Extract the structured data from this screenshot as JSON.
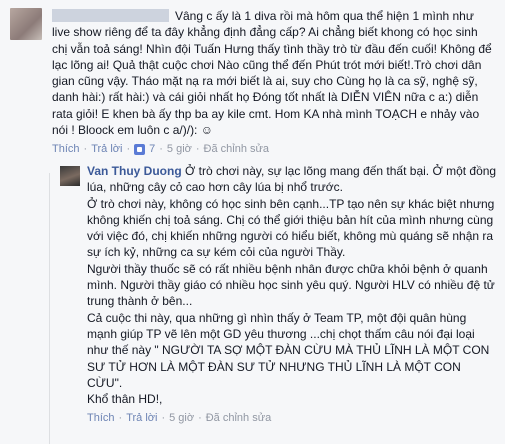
{
  "comment1": {
    "text": "Vâng c ấy là 1 diva rồi mà hôm qua thể hiện 1 mình như live show riêng để ta đây khẳng định đẳng cấp? Ai chẳng biết khong có học sinh chị vẫn toả sáng! Nhìn đội Tuấn Hưng thấy tình thầy trò từ đầu đến cuối! Không để lạc lõng ai! Quả thật cuộc chơi Nào cũng thể đến Phút trót mới biết!.Trò chơi dân gian cũng vậy. Tháo mặt nạ ra mới biết là ai, suy cho Cùng họ là ca sỹ, nghệ sỹ, danh hài:) rất hài:) và cái giỏi nhất họ Đóng tốt nhất là DIỄN VIÊN nữa c a:) diễn rata giỏi! E khen bà ấy thp ba ay kile cmt. Hom KA nhà mình TOẠCH e nhảy vào nói ! Bloock em luôn c a/)/): ☺",
    "actions": {
      "like": "Thích",
      "reply": "Trả lời",
      "like_count": "7",
      "time": "5 giờ",
      "edited": "Đã chỉnh sửa"
    }
  },
  "comment2": {
    "author": "Van Thuy Duong",
    "text": "Ở trò chơi này, sự lạc lõng mang đến thất bại. Ở một đồng lúa, những cây cỏ cao hơn cây lúa bị nhổ trước.\nỞ trò chơi này, không có học sinh bên cạnh...TP tạo nên sự khác biệt nhưng không khiến chị toả sáng. Chị có thể giới thiệu bản hít của mình nhưng cùng với việc đó, chị khiến những người có hiểu biết, không mù quáng sẽ nhận ra sự ích kỷ, những ca sự kém cỏi của người Thầy.\nNgười thầy thuốc sẽ có rất nhiều bệnh nhân được chữa khỏi bệnh ở quanh mình. Người thầy giáo có nhiều học sinh yêu quý. Người HLV có nhiều đệ tử trung thành ở bên...\nCả cuộc thi này, qua những gì nhìn thấy ở Team TP, một đội quân hùng mạnh giúp TP vẽ lên một GD yêu thương ...chị chọt thấm câu nói đại loại như thế này \" NGƯỜI TA SỢ MỘT ĐÀN CỪU MÀ THỦ LĨNH LÀ MỘT CON SƯ TỬ HƠN LÀ MỘT ĐÀN SƯ TỬ NHƯNG THỦ LĨNH LÀ MỘT CON CỪU\".\nKhổ thân HD!,",
    "actions": {
      "like": "Thích",
      "reply": "Trả lời",
      "time": "5 giờ",
      "edited": "Đã chỉnh sửa"
    }
  },
  "icons": {
    "options": "chevron-down-icon"
  }
}
